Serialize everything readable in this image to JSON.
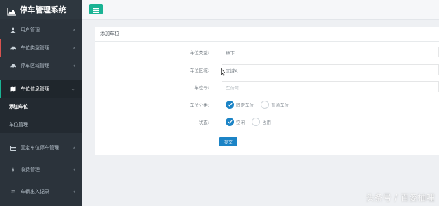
{
  "app": {
    "title": "停车管理系统"
  },
  "sidebar": {
    "items": [
      {
        "label": "用户管理",
        "icon": "user-icon"
      },
      {
        "label": "车位类型管理",
        "icon": "car-icon"
      },
      {
        "label": "停车区域管理",
        "icon": "car-icon"
      },
      {
        "label": "车位信息管理",
        "icon": "map-icon",
        "expanded": true
      },
      {
        "label": "固定车位停车管理",
        "icon": "card-icon"
      },
      {
        "label": "收费管理",
        "icon": "dollar-icon"
      },
      {
        "label": "车辆出入记录",
        "icon": "exchange-icon"
      }
    ],
    "subitems": [
      {
        "label": "添加车位",
        "current": true
      },
      {
        "label": "车位管理"
      }
    ]
  },
  "panel": {
    "title": "添加车位"
  },
  "form": {
    "type": {
      "label": "车位类型:",
      "value": "地下"
    },
    "area": {
      "label": "车位区域:",
      "value": "区域A"
    },
    "number": {
      "label": "车位号:",
      "placeholder": "车位号"
    },
    "category": {
      "label": "车位分类:",
      "options": [
        "固定车位",
        "普通车位"
      ],
      "selected": "固定车位"
    },
    "status": {
      "label": "状态:",
      "options": [
        "空闲",
        "占用"
      ],
      "selected": "空闲"
    },
    "submit_label": "提交"
  },
  "watermark": "头条号 / 百姿柚哩",
  "colors": {
    "sidebar_bg": "#2b333b",
    "accent_green": "#1ab394",
    "primary_blue": "#1c84c6"
  }
}
